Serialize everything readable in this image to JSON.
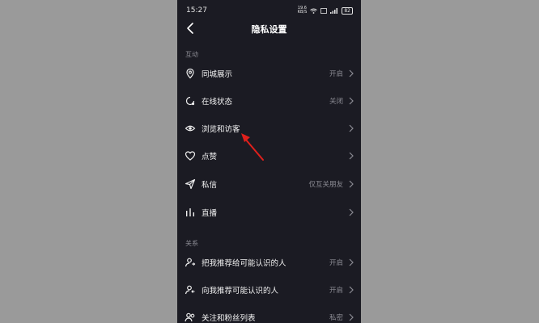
{
  "status_bar": {
    "time": "15:27",
    "signal_text": "19.6 KB/S",
    "battery": "82"
  },
  "header": {
    "title": "隐私设置"
  },
  "sections": [
    {
      "label": "互动",
      "items": [
        {
          "label": "同城展示",
          "value": "开启",
          "icon": "location-pin-icon"
        },
        {
          "label": "在线状态",
          "value": "关闭",
          "icon": "online-status-icon"
        },
        {
          "label": "浏览和访客",
          "value": "",
          "icon": "eye-icon"
        },
        {
          "label": "点赞",
          "value": "",
          "icon": "heart-icon"
        },
        {
          "label": "私信",
          "value": "仅互关朋友",
          "icon": "send-icon"
        },
        {
          "label": "直播",
          "value": "",
          "icon": "live-bars-icon"
        }
      ]
    },
    {
      "label": "关系",
      "items": [
        {
          "label": "把我推荐给可能认识的人",
          "value": "开启",
          "icon": "user-recommend-icon"
        },
        {
          "label": "向我推荐可能认识的人",
          "value": "开启",
          "icon": "user-suggest-icon"
        },
        {
          "label": "关注和粉丝列表",
          "value": "私密",
          "icon": "users-icon"
        }
      ]
    }
  ],
  "colors": {
    "background": "#9a9a9a",
    "phone_bg": "#1b1b23",
    "secondary_text": "#8b8b93",
    "annotation_arrow": "#e0201c"
  }
}
